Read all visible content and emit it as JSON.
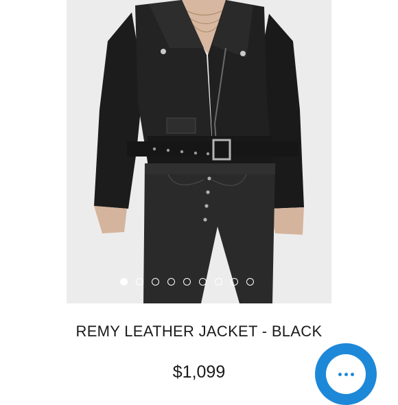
{
  "product": {
    "title": "REMY LEATHER JACKET - BLACK",
    "price": "$1,099",
    "image": {
      "subject": "model wearing black leather moto jacket with belt, black high-waist jeans",
      "background_color": "#ececec"
    }
  },
  "carousel": {
    "total": 9,
    "active_index": 0
  },
  "chat": {
    "icon": "ellipsis-icon",
    "accent_color": "#1e88d8"
  }
}
